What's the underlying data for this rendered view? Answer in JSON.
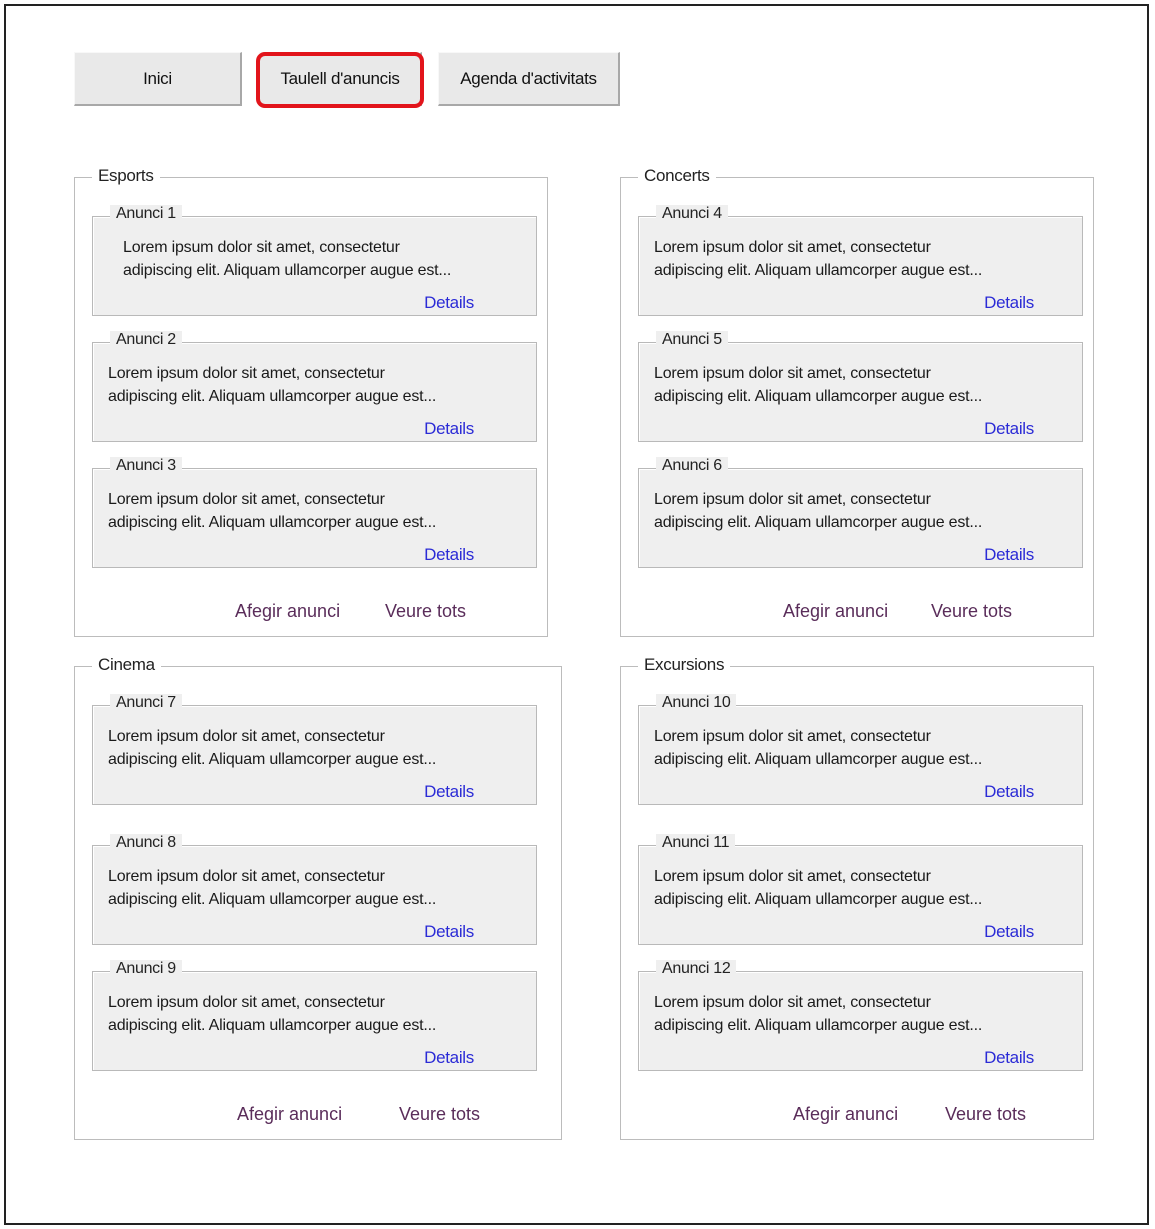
{
  "nav": {
    "home": "Inici",
    "board": "Taulell d'anuncis",
    "agenda": "Agenda d'activitats"
  },
  "groups": [
    {
      "title": "Esports",
      "ads": [
        {
          "title": "Anunci 1",
          "line1": "Lorem ipsum dolor sit amet, consectetur",
          "line2": "adipiscing elit. Aliquam ullamcorper augue est...",
          "link": "Details"
        },
        {
          "title": "Anunci 2",
          "line1": "Lorem ipsum dolor sit amet, consectetur",
          "line2": "adipiscing elit. Aliquam ullamcorper augue est...",
          "link": "Details"
        },
        {
          "title": "Anunci 3",
          "line1": "Lorem ipsum dolor sit amet, consectetur",
          "line2": "adipiscing elit. Aliquam ullamcorper augue est...",
          "link": "Details"
        }
      ],
      "add_label": "Afegir anunci",
      "view_all_label": "Veure tots"
    },
    {
      "title": "Concerts",
      "ads": [
        {
          "title": "Anunci 4",
          "line1": "Lorem ipsum dolor sit amet, consectetur",
          "line2": "adipiscing elit. Aliquam ullamcorper augue est...",
          "link": "Details"
        },
        {
          "title": "Anunci 5",
          "line1": "Lorem ipsum dolor sit amet, consectetur",
          "line2": "adipiscing elit. Aliquam ullamcorper augue est...",
          "link": "Details"
        },
        {
          "title": "Anunci 6",
          "line1": "Lorem ipsum dolor sit amet, consectetur",
          "line2": "adipiscing elit. Aliquam ullamcorper augue est...",
          "link": "Details"
        }
      ],
      "add_label": "Afegir anunci",
      "view_all_label": "Veure tots"
    },
    {
      "title": "Cinema",
      "ads": [
        {
          "title": "Anunci 7",
          "line1": "Lorem ipsum dolor sit amet, consectetur",
          "line2": "adipiscing elit. Aliquam ullamcorper augue est...",
          "link": "Details"
        },
        {
          "title": "Anunci 8",
          "line1": "Lorem ipsum dolor sit amet, consectetur",
          "line2": "adipiscing elit. Aliquam ullamcorper augue est...",
          "link": "Details"
        },
        {
          "title": "Anunci 9",
          "line1": "Lorem ipsum dolor sit amet, consectetur",
          "line2": "adipiscing elit. Aliquam ullamcorper augue est...",
          "link": "Details"
        }
      ],
      "add_label": "Afegir anunci",
      "view_all_label": "Veure tots"
    },
    {
      "title": "Excursions",
      "ads": [
        {
          "title": "Anunci 10",
          "line1": "Lorem ipsum dolor sit amet, consectetur",
          "line2": "adipiscing elit. Aliquam ullamcorper augue est...",
          "link": "Details"
        },
        {
          "title": "Anunci 11",
          "line1": "Lorem ipsum dolor sit amet, consectetur",
          "line2": "adipiscing elit. Aliquam ullamcorper augue est...",
          "link": "Details"
        },
        {
          "title": "Anunci 12",
          "line1": "Lorem ipsum dolor sit amet, consectetur",
          "line2": "adipiscing elit. Aliquam ullamcorper augue est...",
          "link": "Details"
        }
      ],
      "add_label": "Afegir anunci",
      "view_all_label": "Veure tots"
    }
  ],
  "colors": {
    "highlight": "#e2141b",
    "link": "#2b2bd6",
    "action_link": "#5a2d5a",
    "ad_background": "#efefef"
  }
}
